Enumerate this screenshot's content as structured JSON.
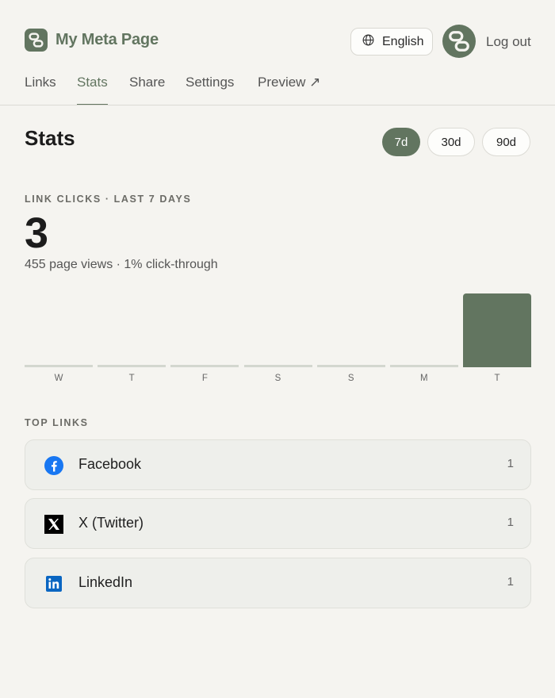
{
  "brand": {
    "name": "My Meta Page",
    "logo_icon": "chain-link-logo-icon",
    "color": "#627560"
  },
  "header": {
    "language_label": "English",
    "language_icon": "globe-icon",
    "logout_label": "Log out"
  },
  "tabs": [
    {
      "label": "Links",
      "active": false
    },
    {
      "label": "Stats",
      "active": true
    },
    {
      "label": "Share",
      "active": false
    },
    {
      "label": "Settings",
      "active": false
    },
    {
      "label": "Preview ↗",
      "active": false
    }
  ],
  "page": {
    "title": "Stats"
  },
  "ranges": [
    {
      "label": "7d",
      "active": true
    },
    {
      "label": "30d",
      "active": false
    },
    {
      "label": "90d",
      "active": false
    }
  ],
  "summary": {
    "label": "LINK CLICKS · LAST 7 DAYS",
    "total": "3",
    "subline": "455 page views · 1% click-through"
  },
  "chart_data": {
    "type": "bar",
    "categories": [
      "W",
      "T",
      "F",
      "S",
      "S",
      "M",
      "T"
    ],
    "values": [
      0,
      0,
      0,
      0,
      0,
      0,
      3
    ],
    "ylim": [
      0,
      3
    ],
    "color": "#627560",
    "empty_color": "#d3d7cf"
  },
  "top_links": {
    "label": "TOP LINKS",
    "items": [
      {
        "name": "Facebook",
        "count": "1",
        "icon": "facebook-icon"
      },
      {
        "name": "X (Twitter)",
        "count": "1",
        "icon": "x-twitter-icon"
      },
      {
        "name": "LinkedIn",
        "count": "1",
        "icon": "linkedin-icon"
      }
    ]
  }
}
